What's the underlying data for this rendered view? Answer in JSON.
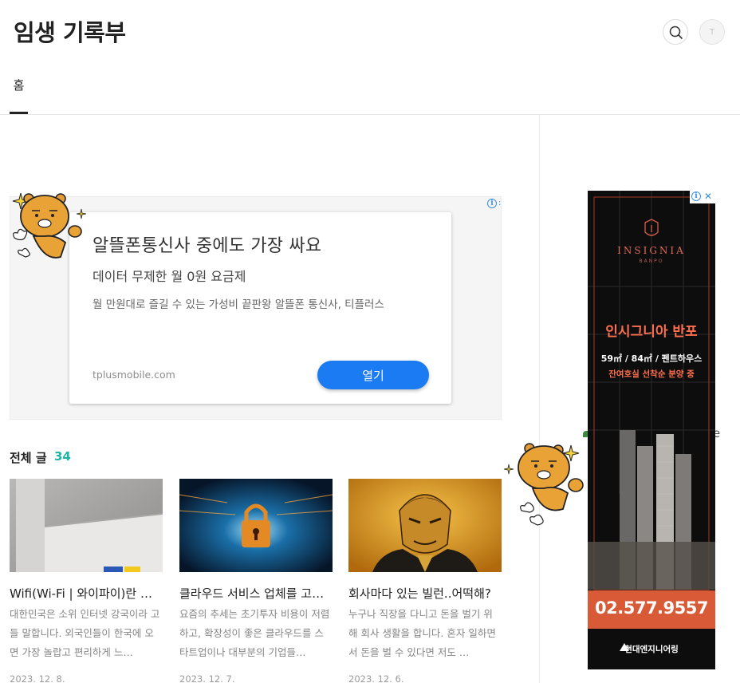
{
  "header": {
    "blog_title": "임생 기록부",
    "avatar_initial": "T",
    "tabs": [
      {
        "label": "홈"
      }
    ]
  },
  "main_ad": {
    "headline": "알뜰폰통신사 중에도 가장 싸요",
    "subhead": "데이터 무제한 월 0원 요금제",
    "description": "월 만원대로 즐길 수 있는 가성비 끝판왕 알뜰폰 통신사, 티플러스",
    "url": "tplusmobile.com",
    "button_label": "열기"
  },
  "posts_section": {
    "label": "전체 글",
    "count": "34"
  },
  "posts": [
    {
      "title": "Wifi(Wi-Fi | 와이파이)란 무엇인가",
      "summary": "대한민국은 소위 인터넷 강국이라 고들 말합니다. 외국인들이 한국에 오면 가장 놀랍고 편리하게 느…",
      "date": "2023. 12. 8."
    },
    {
      "title": "클라우드 서비스 업체를 고르는 법",
      "summary": "요즘의 추세는 초기투자 비용이 저렴하고, 확장성이 좋은 클라우드를 스타트업이나 대부분의 기업들…",
      "date": "2023. 12. 7."
    },
    {
      "title": "회사마다 있는 빌런..어떡해?",
      "summary": "누구나 직장을 다니고 돈을 벌기 위해 회사 생활을 합니다. 혼자 일하면서 돈을 벌 수 있다면 저도 …",
      "date": "2023. 12. 6."
    }
  ],
  "side_ad": {
    "brand": "INSIGNIA",
    "brand_sub": "BANPO",
    "name": "인시그니아 반포",
    "size": "59㎡ / 84㎡ / 펜트하우스",
    "status": "잔여호실 선착순 분양 중",
    "phone": "02.577.9557",
    "company": "현대엔지니어링"
  },
  "sidebar_fragment": "e",
  "colors": {
    "accent_count": "#1bb5a8",
    "ad_button": "#1a7bf2",
    "side_ad_orange": "#ff6f4f",
    "side_ad_phone_bar": "#d85a36"
  }
}
